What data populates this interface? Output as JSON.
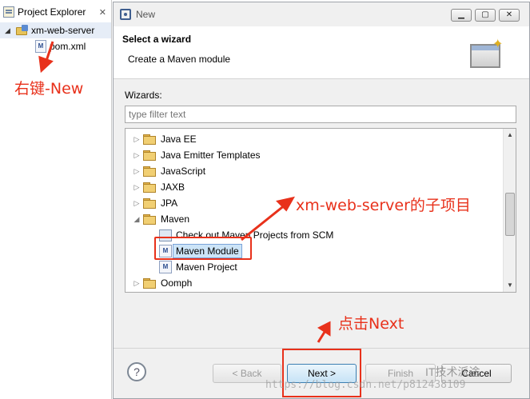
{
  "explorer": {
    "title": "Project Explorer",
    "close_glyph": "✕",
    "project": "xm-web-server",
    "file": "pom.xml"
  },
  "dialog": {
    "title": "New",
    "header_title": "Select a wizard",
    "header_subtitle": "Create a Maven module",
    "wizards_label": "Wizards:",
    "filter_placeholder": "type filter text",
    "items": [
      {
        "label": "Java EE",
        "kind": "folder",
        "expanded": false
      },
      {
        "label": "Java Emitter Templates",
        "kind": "folder",
        "expanded": false
      },
      {
        "label": "JavaScript",
        "kind": "folder",
        "expanded": false
      },
      {
        "label": "JAXB",
        "kind": "folder",
        "expanded": false
      },
      {
        "label": "JPA",
        "kind": "folder",
        "expanded": false
      },
      {
        "label": "Maven",
        "kind": "folder",
        "expanded": true
      },
      {
        "label": "Check out Maven Projects from SCM",
        "kind": "wizard-scm"
      },
      {
        "label": "Maven Module",
        "kind": "wizard-maven",
        "selected": true
      },
      {
        "label": "Maven Project",
        "kind": "wizard-maven"
      },
      {
        "label": "Oomph",
        "kind": "folder",
        "expanded": false
      }
    ],
    "buttons": {
      "help": "?",
      "back": "< Back",
      "next": "Next >",
      "finish": "Finish",
      "cancel": "Cancel"
    }
  },
  "annotations": {
    "right_click_new": "右键-New",
    "sub_project": "xm-web-server的子项目",
    "click_next": "点击Next"
  },
  "watermark": {
    "brand": "IT技术派途",
    "url": "https://blog.csdn.net/p812438109"
  },
  "colors": {
    "annotation_red": "#e8311b",
    "selection_blue": "#cce4f7"
  }
}
